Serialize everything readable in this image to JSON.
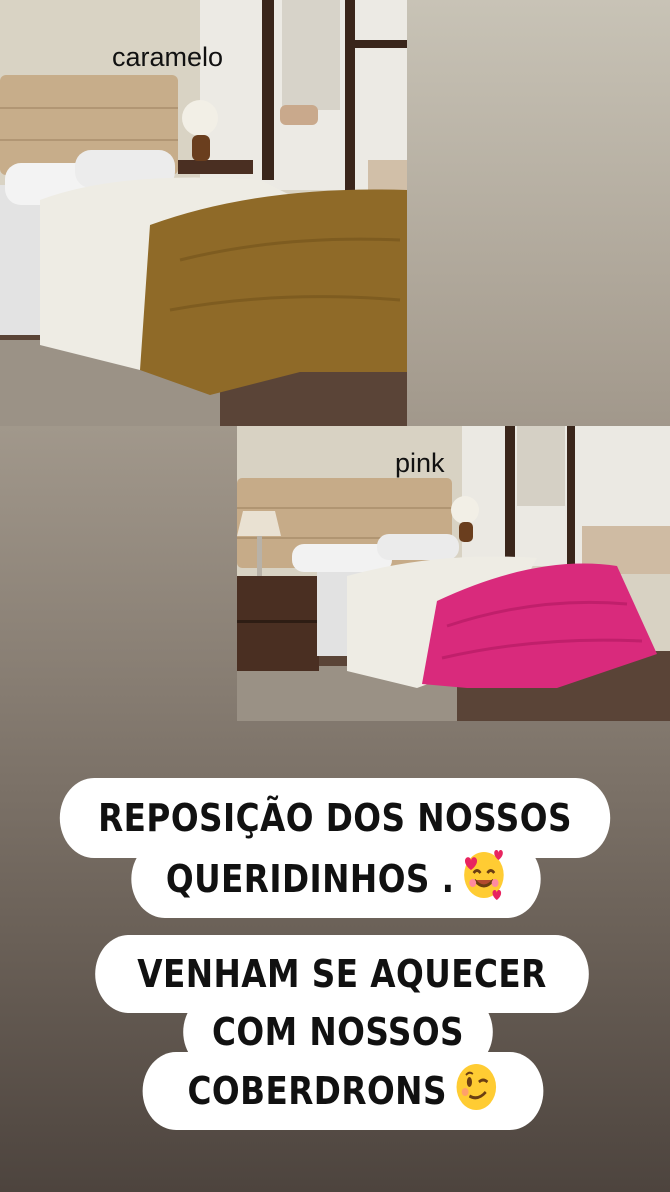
{
  "photos": [
    {
      "label": "caramelo",
      "comforter_color": "#8f6a28"
    },
    {
      "label": "pink",
      "comforter_color": "#d92a7c"
    }
  ],
  "caption_1": {
    "line_1": "REPOSIÇÃO DOS NOSSOS",
    "line_2": "QUERIDINHOS .",
    "emoji": "smiling-face-with-hearts-icon"
  },
  "caption_2": {
    "line_1": "VENHAM SE AQUECER",
    "line_2": "COM NOSSOS",
    "line_3": "COBERDRONS",
    "emoji": "winking-face-icon"
  }
}
